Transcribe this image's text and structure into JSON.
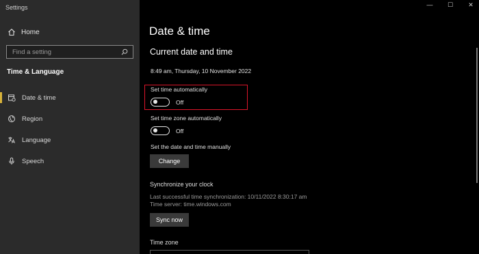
{
  "window": {
    "app_title": "Settings",
    "minimize_glyph": "—",
    "maximize_glyph": "☐",
    "close_glyph": "✕"
  },
  "sidebar": {
    "home_label": "Home",
    "home_icon": "home-icon",
    "search": {
      "placeholder": "Find a setting",
      "value": "",
      "icon": "search-icon"
    },
    "section_title": "Time & Language",
    "items": [
      {
        "label": "Date & time",
        "icon": "calendar-clock-icon",
        "active": true
      },
      {
        "label": "Region",
        "icon": "globe-icon",
        "active": false
      },
      {
        "label": "Language",
        "icon": "language-icon",
        "active": false
      },
      {
        "label": "Speech",
        "icon": "microphone-icon",
        "active": false
      }
    ]
  },
  "main": {
    "title": "Date & time",
    "current_heading": "Current date and time",
    "current_value": "8:49 am, Thursday, 10 November 2022",
    "set_time_auto": {
      "label": "Set time automatically",
      "state": "Off"
    },
    "set_tz_auto": {
      "label": "Set time zone automatically",
      "state": "Off"
    },
    "manual": {
      "label": "Set the date and time manually",
      "button": "Change"
    },
    "sync": {
      "heading": "Synchronize your clock",
      "last_sync": "Last successful time synchronization: 10/11/2022 8:30:17 am",
      "server": "Time server: time.windows.com",
      "button": "Sync now"
    },
    "time_zone_label": "Time zone"
  },
  "colors": {
    "sidebar_bg": "#2b2b2b",
    "main_bg": "#000000",
    "accent": "#d7b23a",
    "highlight_box": "#e0162b",
    "button_bg": "#3a3a3a"
  }
}
